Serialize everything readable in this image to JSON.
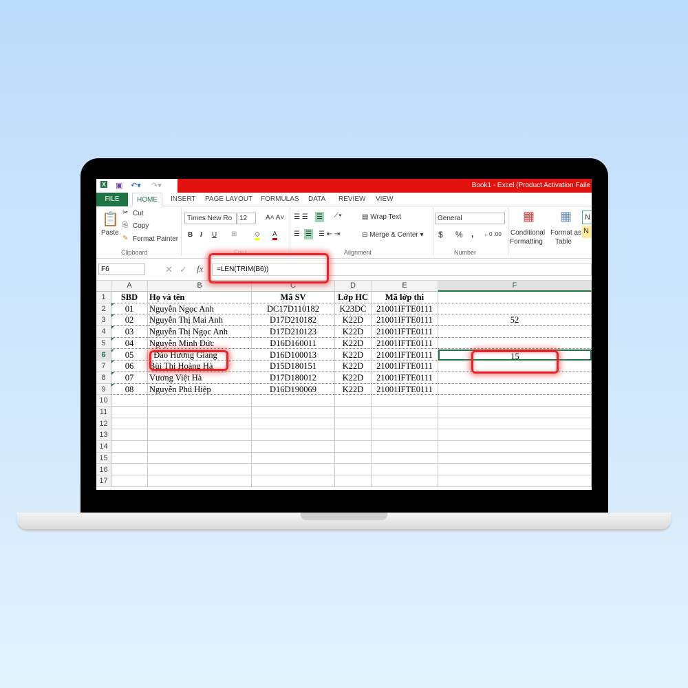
{
  "window": {
    "title": "Book1 -  Excel (Product Activation Faile"
  },
  "tabs": [
    "FILE",
    "HOME",
    "INSERT",
    "PAGE LAYOUT",
    "FORMULAS",
    "DATA",
    "REVIEW",
    "VIEW"
  ],
  "ribbon": {
    "clipboard": {
      "paste": "Paste",
      "cut": "Cut",
      "copy": "Copy",
      "format_painter": "Format Painter",
      "group": "Clipboard"
    },
    "font": {
      "name": "Times New Ro",
      "size": "12",
      "bold": "B",
      "italic": "I",
      "underline": "U",
      "group": "Font"
    },
    "alignment": {
      "wrap": "Wrap Text",
      "merge": "Merge & Center",
      "group": "Alignment"
    },
    "number": {
      "format": "General",
      "currency": "$",
      "percent": "%",
      "comma": ",",
      "group": "Number"
    },
    "styles": {
      "conditional": "Conditional",
      "conditional2": "Formatting",
      "format_table": "Format as",
      "format_table2": "Table",
      "normal": "N"
    }
  },
  "formula_bar": {
    "name_box": "F6",
    "fx": "fx",
    "formula": "=LEN(TRIM(B6))"
  },
  "sheet": {
    "columns": [
      "A",
      "B",
      "C",
      "D",
      "E",
      "F"
    ],
    "row_numbers": [
      "1",
      "2",
      "3",
      "4",
      "5",
      "6",
      "7",
      "8",
      "9",
      "10",
      "11",
      "12",
      "13",
      "14",
      "15",
      "16",
      "17"
    ],
    "selected_cell": "F6",
    "rows": [
      [
        "SBD",
        "Họ và tên",
        "Mã SV",
        "Lớp HC",
        "Mã lớp thi",
        ""
      ],
      [
        "01",
        "Nguyễn Ngọc Anh",
        "DC17D110182",
        "K23DC",
        "21001IFTE0111",
        ""
      ],
      [
        "02",
        "Nguyễn Thị Mai Anh",
        "D17D210182",
        "K22D",
        "21001IFTE0111",
        "52"
      ],
      [
        "03",
        "Nguyễn Thị Ngọc Anh",
        "D17D210123",
        "K22D",
        "21001IFTE0111",
        ""
      ],
      [
        "04",
        "Nguyễn Minh Đức",
        "D16D160011",
        "K22D",
        "21001IFTE0111",
        ""
      ],
      [
        "05",
        "  Đào Hương Giang",
        "D16D100013",
        "K22D",
        "21001IFTE0111",
        "15"
      ],
      [
        "06",
        "Bùi Thị Hoàng Hà",
        "D15D180151",
        "K22D",
        "21001IFTE0111",
        ""
      ],
      [
        "07",
        "Vương Việt Hà",
        "D17D180012",
        "K22D",
        "21001IFTE0111",
        ""
      ],
      [
        "08",
        "Nguyễn Phú Hiệp",
        "D16D190069",
        "K22D",
        "21001IFTE0111",
        ""
      ]
    ]
  },
  "colors": {
    "excel_green": "#217346",
    "title_red": "#e3120f",
    "highlight": "#e8242a"
  }
}
